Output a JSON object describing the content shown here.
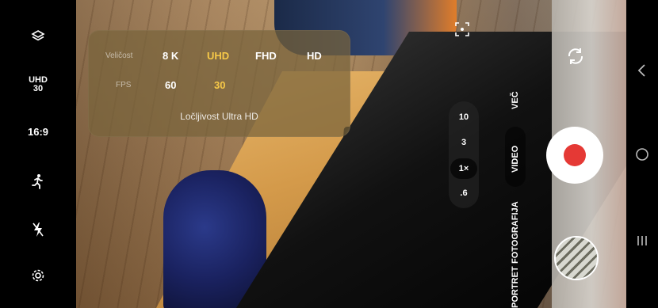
{
  "left_bar": {
    "top_icon": "layers-icon",
    "resolution_line1": "UHD",
    "resolution_line2": "30",
    "aspect_ratio": "16:9",
    "motion_icon": "running-person-icon",
    "flash_icon": "flash-off-icon",
    "settings_icon": "gear-icon"
  },
  "settings_panel": {
    "size_label": "Veličost",
    "size_options": [
      "8 K",
      "UHD",
      "FHD",
      "HD"
    ],
    "size_selected": "UHD",
    "fps_label": "FPS",
    "fps_options": [
      "60",
      "30"
    ],
    "fps_selected": "30",
    "caption": "Ločljivost Ultra HD",
    "accent_color": "#f7c948"
  },
  "zoom": {
    "levels": [
      "10",
      "3",
      "1×",
      ".6"
    ],
    "active": "1×"
  },
  "modes": {
    "more": "VEČ",
    "video": "VIDEO",
    "photo": "FOTOGRAFIJA",
    "portrait": "PORTRET",
    "active": "VIDEO"
  },
  "controls": {
    "record_icon": "record-icon",
    "record_color": "#e53935",
    "flip_icon": "flip-camera-icon",
    "focus_icon": "focus-icon",
    "gallery_icon": "gallery-thumbnail"
  },
  "nav": {
    "back_icon": "back-icon",
    "home_icon": "home-icon",
    "recents_icon": "recents-icon"
  }
}
